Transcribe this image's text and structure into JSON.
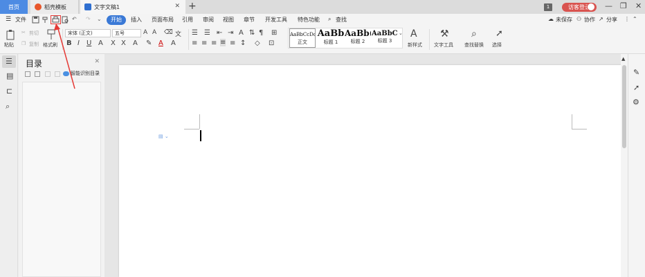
{
  "tabs": {
    "home": "首页",
    "template": "稻壳模板",
    "document": "文字文稿1",
    "window_count": "1",
    "visitor_login": "访客登录"
  },
  "menu": {
    "file": "文件",
    "items": [
      "开始",
      "插入",
      "页面布局",
      "引用",
      "审阅",
      "视图",
      "章节",
      "开发工具",
      "特色功能"
    ],
    "search": "查找",
    "unsaved": "未保存",
    "collab": "协作",
    "share": "分享"
  },
  "ribbon": {
    "paste": "粘贴",
    "cut": "剪切",
    "copy": "复制",
    "format_painter": "格式刷",
    "font_name": "宋体 (正文)",
    "font_size": "五号",
    "bold": "B",
    "italic": "I",
    "underline": "U",
    "styles": [
      {
        "sample": "AaBbCcDd",
        "name": "正文"
      },
      {
        "sample": "AaBb",
        "name": "标题 1"
      },
      {
        "sample": "AaBb(",
        "name": "标题 2"
      },
      {
        "sample": "AaBbC(",
        "name": "标题 3"
      }
    ],
    "new_style": "新样式",
    "text_tools": "文字工具",
    "find_replace": "查找替换",
    "select": "选择"
  },
  "toc": {
    "title": "目录",
    "smart_toc": "智能识别目录"
  },
  "colors": {
    "accent": "#3a79d6",
    "home_tab": "#4d8be3",
    "visitor": "#d9534f",
    "annotation": "#e53935"
  }
}
